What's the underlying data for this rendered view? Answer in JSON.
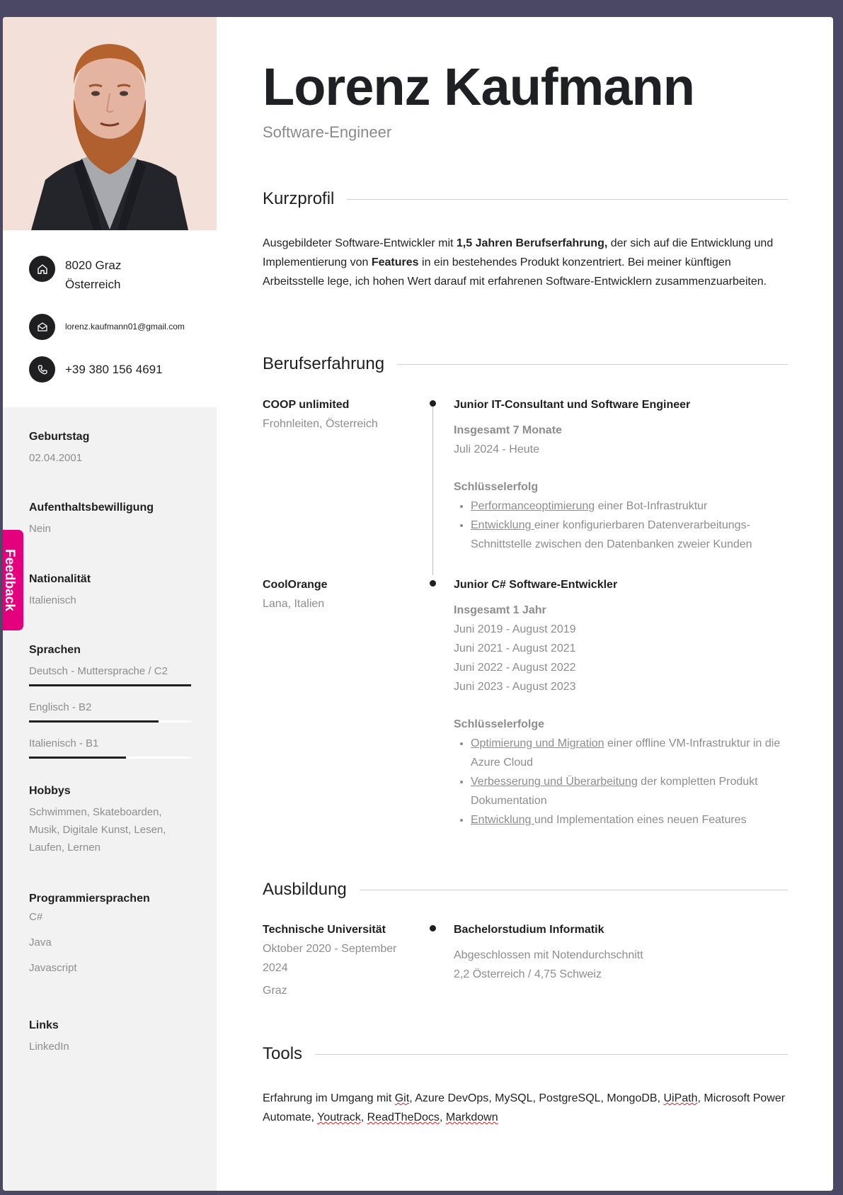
{
  "sidebar": {
    "contact": {
      "address_line1": "8020  Graz",
      "address_line2": "Österreich",
      "email": "lorenz.kaufmann01@gmail.com",
      "phone": "+39 380 156 4691",
      "icons": [
        "home-icon",
        "mail-icon",
        "phone-icon"
      ]
    },
    "birthday": {
      "label": "Geburtstag",
      "value": "02.04.2001"
    },
    "residence": {
      "label": "Aufenthaltsbewilligung",
      "value": "Nein"
    },
    "nationality": {
      "label": "Nationalität",
      "value": "Italienisch"
    },
    "languages": {
      "label": "Sprachen",
      "items": [
        {
          "text": "Deutsch  -  Muttersprache / C2",
          "level": 1.0
        },
        {
          "text": "Englisch  -  B2",
          "level": 0.8
        },
        {
          "text": "Italienisch  -  B1",
          "level": 0.6
        }
      ]
    },
    "hobbies": {
      "label": "Hobbys",
      "value": "Schwimmen, Skateboarden, Musik, Digitale Kunst, Lesen, Laufen, Lernen"
    },
    "programming": {
      "label": "Programmiersprachen",
      "items": [
        "C#",
        "Java",
        "Javascript"
      ]
    },
    "links": {
      "label": "Links",
      "items": [
        "LinkedIn"
      ]
    }
  },
  "feedback_tab": "Feedback",
  "header": {
    "name": "Lorenz Kaufmann",
    "role": "Software-Engineer"
  },
  "profile": {
    "title": "Kurzprofil",
    "text_1": "Ausgebildeter Software-Entwickler mit ",
    "bold_1": "1,5 Jahren Berufserfahrung,",
    "text_2": " der sich auf die Entwicklung und Implementierung von ",
    "bold_2": "Features",
    "text_3": " in ein bestehendes Produkt konzentriert. Bei meiner künftigen Arbeitsstelle lege, ich hohen Wert darauf mit erfahrenen Software-Entwicklern zusammenzuarbeiten."
  },
  "experience": {
    "title": "Berufserfahrung",
    "jobs": [
      {
        "company": "COOP unlimited",
        "location": "Frohnleiten, Österreich",
        "position": "Junior IT-Consultant und Software Engineer",
        "duration": "Insgesamt 7 Monate",
        "dates": [
          "Juli 2024 - Heute"
        ],
        "achievements_title": "Schlüsselerfolg",
        "achievements": [
          {
            "link": "Performanceoptimierung",
            "rest": " einer Bot-Infrastruktur"
          },
          {
            "link": "Entwicklung ",
            "rest": "einer konfigurierbaren Datenverarbeitungs-Schnittstelle zwischen den Datenbanken zweier Kunden"
          }
        ]
      },
      {
        "company": "CoolOrange",
        "location": "Lana, Italien",
        "position": "Junior C# Software-Entwickler",
        "duration": "Insgesamt 1 Jahr",
        "dates": [
          "Juni 2019 - August 2019",
          "Juni 2021 - August 2021",
          "Juni 2022 - August 2022",
          "Juni 2023 - August 2023"
        ],
        "achievements_title": "Schlüsselerfolge",
        "achievements": [
          {
            "link": "Optimierung und Migration",
            "rest": " einer offline VM-Infrastruktur in die Azure Cloud"
          },
          {
            "link": "Verbesserung und Überarbeitung",
            "rest": " der kompletten Produkt Dokumentation"
          },
          {
            "link": "Entwicklung ",
            "rest": "und Implementation eines neuen Features"
          }
        ]
      }
    ]
  },
  "education": {
    "title": "Ausbildung",
    "school": "Technische Universität",
    "period": "Oktober 2020  -  September 2024",
    "city": "Graz",
    "degree": "Bachelorstudium Informatik",
    "detail_1": "Abgeschlossen mit Notendurchschnitt",
    "detail_2": "2,2 Österreich / 4,75 Schweiz"
  },
  "tools": {
    "title": "Tools",
    "prefix": "Erfahrung im Umgang mit ",
    "items": [
      "Git",
      "Azure DevOps",
      "MySQL",
      "PostgreSQL",
      "MongoDB",
      "UiPath",
      "Microsoft Power Automate",
      "Youtrack",
      "ReadTheDocs",
      "Markdown"
    ]
  }
}
